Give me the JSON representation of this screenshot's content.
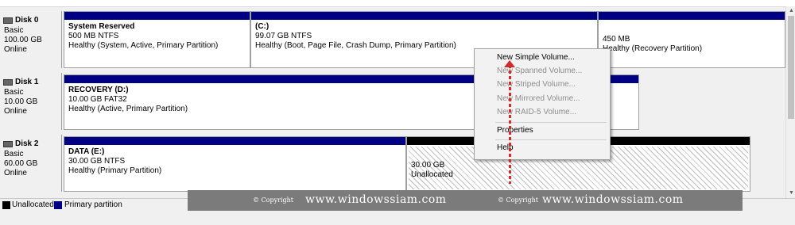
{
  "disks": [
    {
      "name": "Disk 0",
      "type": "Basic",
      "size": "100.00 GB",
      "status": "Online",
      "partitions": [
        {
          "title": "System Reserved",
          "line1": "500 MB NTFS",
          "line2": "Healthy (System, Active, Primary Partition)"
        },
        {
          "title": "(C:)",
          "line1": "99.07 GB NTFS",
          "line2": "Healthy (Boot, Page File, Crash Dump, Primary Partition)"
        },
        {
          "title": "",
          "line1": "450 MB",
          "line2": "Healthy (Recovery Partition)"
        }
      ]
    },
    {
      "name": "Disk 1",
      "type": "Basic",
      "size": "10.00 GB",
      "status": "Online",
      "partitions": [
        {
          "title": "RECOVERY  (D:)",
          "line1": "10.00 GB FAT32",
          "line2": "Healthy (Active, Primary Partition)"
        }
      ]
    },
    {
      "name": "Disk 2",
      "type": "Basic",
      "size": "60.00 GB",
      "status": "Online",
      "partitions": [
        {
          "title": "DATA  (E:)",
          "line1": "30.00 GB NTFS",
          "line2": "Healthy (Primary Partition)"
        },
        {
          "title": "",
          "line1": "30.00 GB",
          "line2": "Unallocated"
        }
      ]
    }
  ],
  "context_menu": {
    "items": [
      {
        "label": "New Simple Volume...",
        "enabled": true
      },
      {
        "label": "New Spanned Volume...",
        "enabled": false
      },
      {
        "label": "New Striped Volume...",
        "enabled": false
      },
      {
        "label": "New Mirrored Volume...",
        "enabled": false
      },
      {
        "label": "New RAID-5 Volume...",
        "enabled": false
      },
      {
        "label": "Properties",
        "enabled": true
      },
      {
        "label": "Help",
        "enabled": true
      }
    ]
  },
  "legend": {
    "unallocated_label": "Unallocated",
    "primary_label": "Primary partition",
    "unallocated_color": "#000000",
    "primary_color": "#000084"
  },
  "watermark": {
    "copyright": "© Copyright",
    "url": "www.windowssiam.com"
  },
  "colors": {
    "partition_bar": "#000084",
    "unallocated_bar": "#000000",
    "annotation_arrow": "#d12b2b"
  }
}
